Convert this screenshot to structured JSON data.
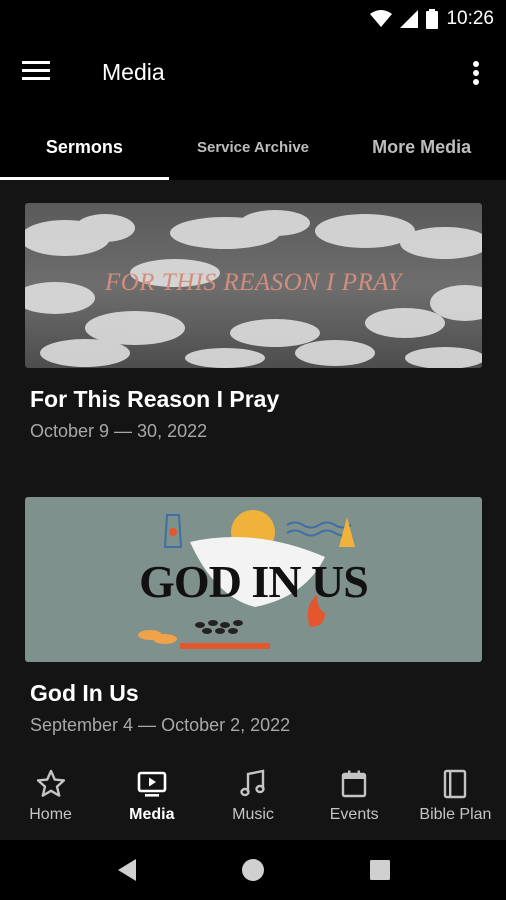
{
  "status_bar": {
    "time": "10:26"
  },
  "app_bar": {
    "title": "Media"
  },
  "tabs": [
    {
      "label": "Sermons",
      "active": true
    },
    {
      "label": "Service Archive",
      "active": false
    },
    {
      "label": "More Media",
      "active": false
    }
  ],
  "cards": [
    {
      "artwork_text": "FOR THIS REASON I PRAY",
      "title": "For This Reason I Pray",
      "date": "October 9 — 30, 2022"
    },
    {
      "artwork_text": "GOD IN US",
      "title": "God In Us",
      "date": "September 4 — October 2, 2022"
    }
  ],
  "bottom_nav": [
    {
      "label": "Home",
      "icon": "star-icon",
      "active": false
    },
    {
      "label": "Media",
      "icon": "tv-play-icon",
      "active": true
    },
    {
      "label": "Music",
      "icon": "music-note-icon",
      "active": false
    },
    {
      "label": "Events",
      "icon": "calendar-icon",
      "active": false
    },
    {
      "label": "Bible Plan",
      "icon": "book-icon",
      "active": false
    }
  ],
  "colors": {
    "background": "#141414",
    "bar": "#000000",
    "accent": "#ffffff",
    "secondary_text": "#a8a8a8"
  }
}
